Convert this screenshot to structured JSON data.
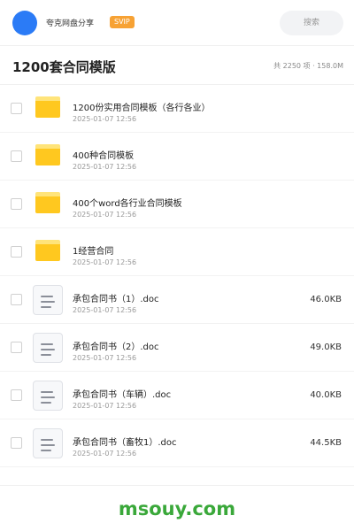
{
  "header": {
    "brand": "夸克网盘分享",
    "badge": "SVIP",
    "search_placeholder": "搜索"
  },
  "folder": {
    "title": "1200套合同模版",
    "summary": "共 2250 项 · 158.0M"
  },
  "items": [
    {
      "type": "folder",
      "name": "1200份实用合同模板（各行各业）",
      "date": "2025-01-07 12:56",
      "size": ""
    },
    {
      "type": "folder",
      "name": "400种合同模板",
      "date": "2025-01-07 12:56",
      "size": ""
    },
    {
      "type": "folder",
      "name": "400个word各行业合同模板",
      "date": "2025-01-07 12:56",
      "size": ""
    },
    {
      "type": "folder",
      "name": "1经营合同",
      "date": "2025-01-07 12:56",
      "size": ""
    },
    {
      "type": "doc",
      "name": "承包合同书（1）.doc",
      "date": "2025-01-07 12:56",
      "size": "46.0KB"
    },
    {
      "type": "doc",
      "name": "承包合同书（2）.doc",
      "date": "2025-01-07 12:56",
      "size": "49.0KB"
    },
    {
      "type": "doc",
      "name": "承包合同书（车辆）.doc",
      "date": "2025-01-07 12:56",
      "size": "40.0KB"
    },
    {
      "type": "doc",
      "name": "承包合同书（畜牧1）.doc",
      "date": "2025-01-07 12:56",
      "size": "44.5KB"
    }
  ],
  "watermark": "msouy.com",
  "colors": {
    "accent": "#2b7bf6",
    "badge": "#f7a234",
    "folder": "#ffc81f",
    "watermark": "#3aa83a"
  }
}
